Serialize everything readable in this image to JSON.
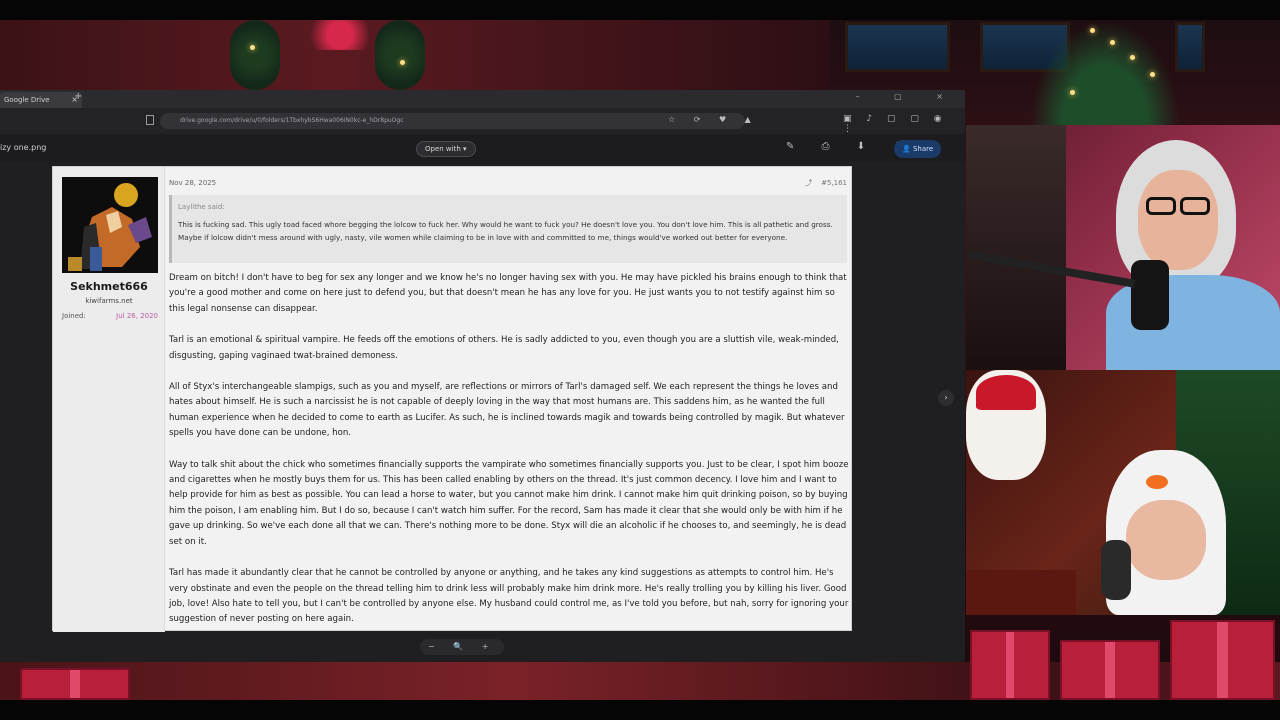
{
  "browser": {
    "tab_title": "Google Drive",
    "tab_close": "×",
    "new_tab": "+",
    "window_controls": "– ▢ ×",
    "url": "drive.google.com/drive/u/0/folders/1TbxhybS6Hwa006iN0kc-e_hDr8puOgc",
    "filename": "izy one.png",
    "open_with_label": "Open with",
    "share_label": "Share"
  },
  "post": {
    "username": "Sekhmet666",
    "user_title": "kiwifarms.net",
    "joined_label": "Joined:",
    "joined_value": "Jul 26, 2020",
    "date": "Nov 28, 2025",
    "post_number": "#5,161",
    "quote_author": "Laylithe said:",
    "quote_text": "This is fucking sad. This ugly toad faced whore begging the lolcow to fuck her. Why would he want to fuck you? He doesn't love you. You don't love him. This is all pathetic and gross. Maybe if lolcow didn't mess around with ugly, nasty, vile women while claiming to be in love with and committed to me, things would've worked out better for everyone.",
    "paragraphs": [
      "Dream on bitch! I don't have to beg for sex any longer and we know he's no longer having sex with you. He may have pickled his brains enough to think that you're a good mother and come on here just to defend you, but that doesn't mean he has any love for you. He just wants you to not testify against him so this legal nonsense can disappear.",
      "Tarl is an emotional & spiritual vampire. He feeds off the emotions of others. He is sadly addicted to you, even though you are a sluttish vile, weak-minded, disgusting, gaping vaginaed twat-brained demoness.",
      "All of Styx's interchangeable slampigs, such as you and myself, are reflections or mirrors of Tarl's damaged self. We each represent the things he loves and hates about himself. He is such a narcissist he is not capable of deeply loving in the way that most humans are. This saddens him, as he wanted the full human experience when he decided to come to earth as Lucifer. As such, he is inclined towards magik and towards being controlled by magik. But whatever spells you have done can be undone, hon.",
      "Way to talk shit about the chick who sometimes financially supports the vampirate who sometimes financially supports you. Just to be clear, I spot him booze and cigarettes when he mostly buys them for us. This has been called enabling by others on the thread. It's just common decency. I love him and I want to help provide for him as best as possible. You can lead a horse to water, but you cannot make him drink. I cannot make him quit drinking poison, so by buying him the poison, I am enabling him. But I do so, because I can't watch him suffer. For the record, Sam has made it clear that she would only be with him if he gave up drinking. So we've each done all that we can. There's nothing more to be done. Styx will die an alcoholic if he chooses to, and seemingly, he is dead set on it.",
      "Tarl has made it abundantly clear that he cannot be controlled by anyone or anything, and he takes any kind suggestions as attempts to control him. He's very obstinate and even the people on the thread telling him to drink less will probably make him drink more. He's really trolling you by killing his liver. Good job, love! Also hate to tell you, but I can't be controlled by anyone else. My husband could control me, as I've told you before, but nah, sorry for ignoring your suggestion of never posting on here again."
    ]
  },
  "icons": {
    "share": "⤴",
    "next": "›",
    "zoom": "− 🔍 +"
  },
  "colors": {
    "accent_share": "#1a3a68",
    "joined_value": "#c05aa6"
  }
}
